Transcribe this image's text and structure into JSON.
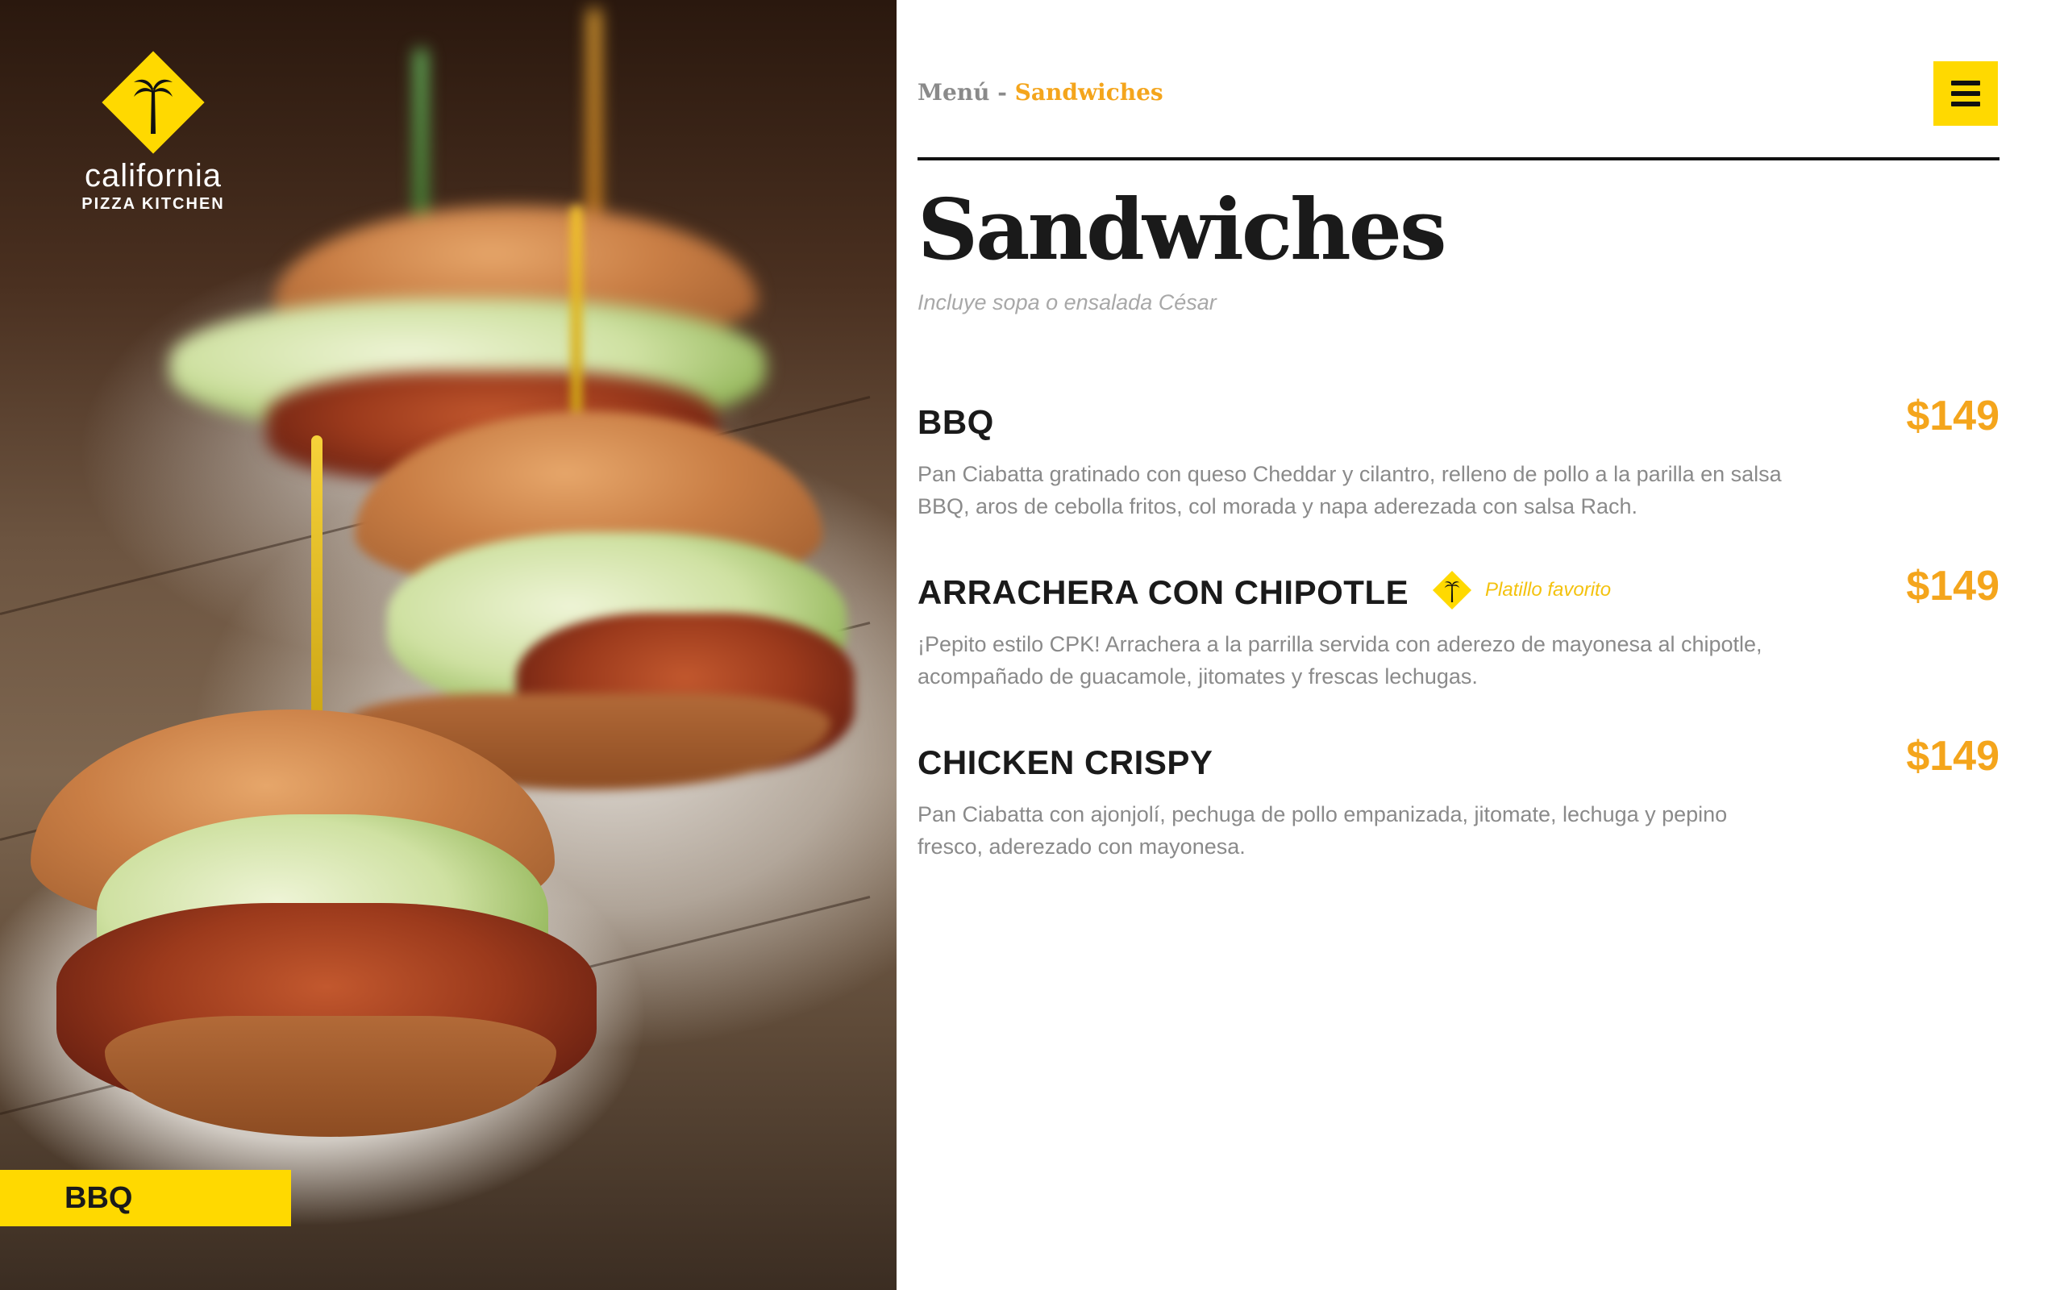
{
  "brand": {
    "name": "california",
    "sub": "PIZZA KITCHEN",
    "accent": "#ffd900",
    "price_color": "#f4a51c"
  },
  "photo": {
    "label": "BBQ"
  },
  "breadcrumb": {
    "root": "Menú",
    "separator": " - ",
    "current": "Sandwiches"
  },
  "header": {
    "menu_icon": "hamburger-icon"
  },
  "page": {
    "title": "Sandwiches",
    "subtitle": "Incluye sopa o ensalada César"
  },
  "items": [
    {
      "name": "BBQ",
      "price": "$149",
      "desc": "Pan Ciabatta gratinado con queso Cheddar y cilantro, relleno de pollo a la parilla en salsa BBQ, aros de cebolla fritos, col morada y napa aderezada con salsa Rach."
    },
    {
      "name": "ARRACHERA CON CHIPOTLE",
      "price": "$149",
      "badge": "Platillo favorito",
      "desc": "¡Pepito estilo CPK! Arrachera a la parrilla servida con aderezo de mayonesa al chipotle, acompañado de guacamole, jitomates y frescas lechugas."
    },
    {
      "name": "CHICKEN CRISPY",
      "price": "$149",
      "desc": "Pan Ciabatta con ajonjolí, pechuga de pollo empanizada, jitomate, lechuga y pepino fresco, aderezado con mayonesa."
    }
  ]
}
